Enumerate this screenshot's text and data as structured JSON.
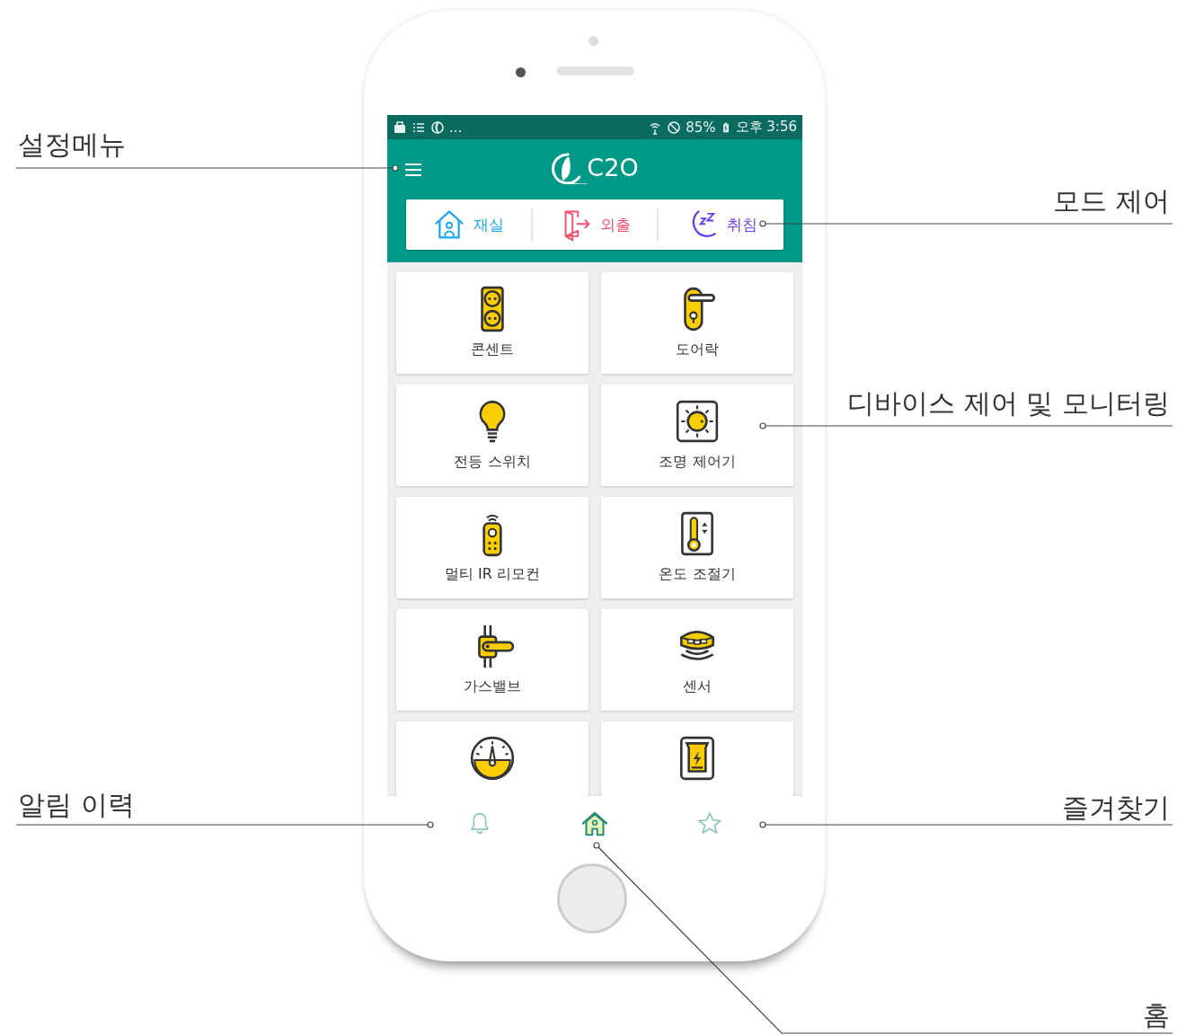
{
  "status_bar": {
    "more": "...",
    "battery": "85%",
    "time": "오후 3:56"
  },
  "app_bar": {
    "logo": "C2O"
  },
  "modes": [
    {
      "label": "재실",
      "kind": "home",
      "color": "#1ea7f0"
    },
    {
      "label": "외출",
      "kind": "out",
      "color": "#f2506b"
    },
    {
      "label": "취침",
      "kind": "sleep",
      "color": "#6a3cf0"
    }
  ],
  "devices": [
    {
      "kind": "outlet",
      "label": "콘센트"
    },
    {
      "kind": "doorlock",
      "label": "도어락"
    },
    {
      "kind": "bulb",
      "label": "전등 스위치"
    },
    {
      "kind": "dimmer",
      "label": "조명 제어기"
    },
    {
      "kind": "remote",
      "label": "멀티 IR 리모컨"
    },
    {
      "kind": "thermostat",
      "label": "온도 조절기"
    },
    {
      "kind": "gasvalve",
      "label": "가스밸브"
    },
    {
      "kind": "sensor",
      "label": "센서"
    },
    {
      "kind": "meter"
    },
    {
      "kind": "switch"
    }
  ],
  "bottom_nav": [
    {
      "kind": "bell",
      "selected": false
    },
    {
      "kind": "home",
      "selected": true
    },
    {
      "kind": "star",
      "selected": false
    }
  ],
  "annotations": [
    {
      "label": "설정메뉴"
    },
    {
      "label": "모드 제어"
    },
    {
      "label": "디바이스 제어 및 모니터링"
    },
    {
      "label": "알림 이력"
    },
    {
      "label": "즐겨찾기"
    },
    {
      "label": "홈"
    }
  ]
}
